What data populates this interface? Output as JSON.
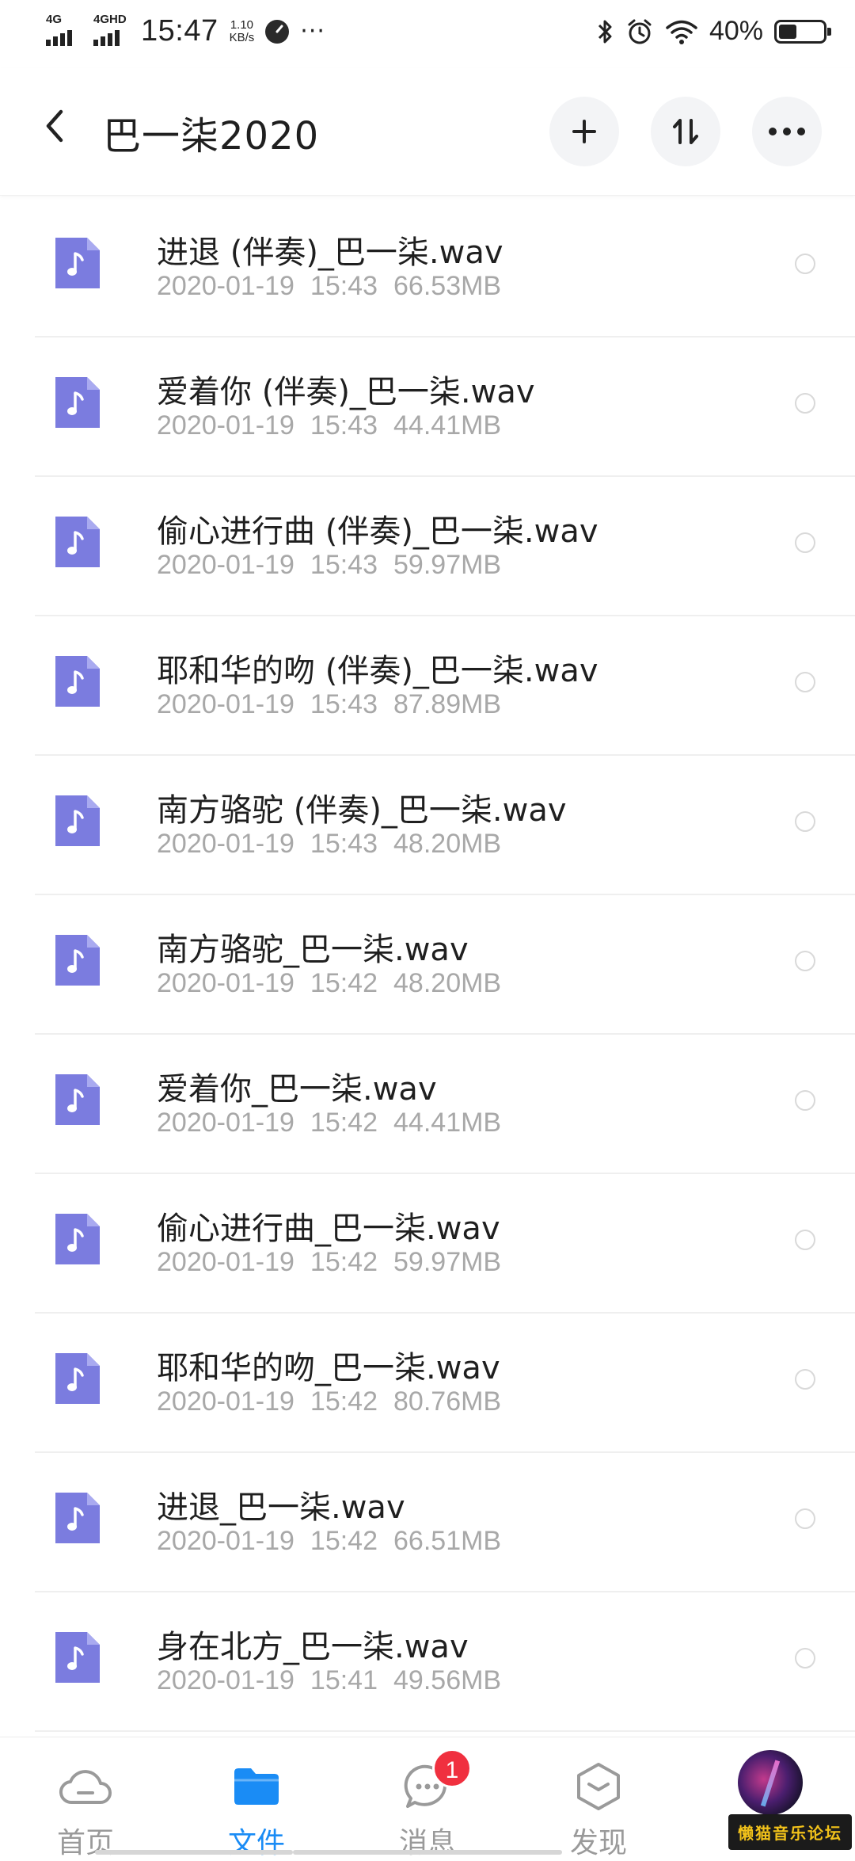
{
  "status_bar": {
    "net1": "4G",
    "net2": "4GHD",
    "time": "15:47",
    "speed_value": "1.10",
    "speed_unit": "KB/s",
    "battery": "40%",
    "battery_level": 0.4
  },
  "header": {
    "title": "巴一柒2020"
  },
  "files": [
    {
      "name": "进退 (伴奏)_巴一柒.wav",
      "date": "2020-01-19",
      "time": "15:43",
      "size": "66.53MB"
    },
    {
      "name": "爱着你 (伴奏)_巴一柒.wav",
      "date": "2020-01-19",
      "time": "15:43",
      "size": "44.41MB"
    },
    {
      "name": "偷心进行曲 (伴奏)_巴一柒.wav",
      "date": "2020-01-19",
      "time": "15:43",
      "size": "59.97MB"
    },
    {
      "name": "耶和华的吻 (伴奏)_巴一柒.wav",
      "date": "2020-01-19",
      "time": "15:43",
      "size": "87.89MB"
    },
    {
      "name": "南方骆驼 (伴奏)_巴一柒.wav",
      "date": "2020-01-19",
      "time": "15:43",
      "size": "48.20MB"
    },
    {
      "name": "南方骆驼_巴一柒.wav",
      "date": "2020-01-19",
      "time": "15:42",
      "size": "48.20MB"
    },
    {
      "name": "爱着你_巴一柒.wav",
      "date": "2020-01-19",
      "time": "15:42",
      "size": "44.41MB"
    },
    {
      "name": "偷心进行曲_巴一柒.wav",
      "date": "2020-01-19",
      "time": "15:42",
      "size": "59.97MB"
    },
    {
      "name": "耶和华的吻_巴一柒.wav",
      "date": "2020-01-19",
      "time": "15:42",
      "size": "80.76MB"
    },
    {
      "name": "进退_巴一柒.wav",
      "date": "2020-01-19",
      "time": "15:42",
      "size": "66.51MB"
    },
    {
      "name": "身在北方_巴一柒.wav",
      "date": "2020-01-19",
      "time": "15:41",
      "size": "49.56MB"
    }
  ],
  "bottom_nav": {
    "home": "首页",
    "files": "文件",
    "messages": "消息",
    "messages_badge": "1",
    "discover": "发现"
  },
  "watermark": "懒猫音乐论坛",
  "colors": {
    "accent": "#1a8cf5",
    "file_icon": "#7b7cdf",
    "badge": "#f0303f"
  }
}
